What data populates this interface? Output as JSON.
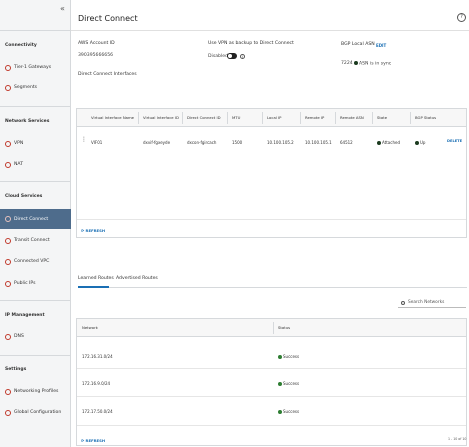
{
  "sidebar": {
    "collapse_glyph": "«",
    "sections": [
      {
        "title": "Connectivity"
      },
      {
        "title": "Network Services"
      },
      {
        "title": "Cloud Services"
      },
      {
        "title": "IP Management"
      },
      {
        "title": "Settings"
      }
    ],
    "items": [
      {
        "label": "Tier-1 Gateways",
        "icon": "gateway-icon"
      },
      {
        "label": "Segments",
        "icon": "segments-icon"
      },
      {
        "label": "VPN",
        "icon": "vpn-icon"
      },
      {
        "label": "NAT",
        "icon": "nat-icon"
      },
      {
        "label": "Direct Connect",
        "icon": "direct-connect-icon",
        "active": true
      },
      {
        "label": "Transit Connect",
        "icon": "transit-connect-icon"
      },
      {
        "label": "Connected VPC",
        "icon": "connected-vpc-icon"
      },
      {
        "label": "Public IPs",
        "icon": "public-ip-icon"
      },
      {
        "label": "DNS",
        "icon": "dns-icon"
      },
      {
        "label": "Networking Profiles",
        "icon": "networking-profiles-icon"
      },
      {
        "label": "Global Configuration",
        "icon": "global-config-icon"
      }
    ]
  },
  "header": {
    "title": "Direct Connect",
    "help_glyph": "?"
  },
  "summary": {
    "account_label": "AWS Account ID",
    "account_value": "390395666656",
    "vpn_label": "Use VPN as backup to Direct Connect",
    "vpn_state": "Disabled",
    "bgp_label": "BGP Local ASN",
    "bgp_edit": "EDIT",
    "bgp_value": "7224",
    "bgp_status": "ASN is in sync",
    "interfaces_label": "Direct Connect Interfaces"
  },
  "interfaces_table": {
    "columns": [
      "Virtual Interface Name",
      "Virtual Interface ID",
      "Direct Connect ID",
      "MTU",
      "Local IP",
      "Remote IP",
      "Remote ASN",
      "State",
      "BGP Status"
    ],
    "rows": [
      {
        "name": "VIF01",
        "vif_id": "dxvif-fgxeyde",
        "dx_id": "dxcon-fgircach",
        "mtu": "1500",
        "local_ip": "10.100.105.2",
        "remote_ip": "10.100.105.1",
        "remote_asn": "64512",
        "state": "Attached",
        "bgp_status": "Up",
        "action": "DELETE"
      }
    ],
    "refresh": "REFRESH"
  },
  "tabs": [
    {
      "label": "Learned Routes",
      "active": true
    },
    {
      "label": "Advertised Routes",
      "active": false
    }
  ],
  "search": {
    "placeholder": "Search Networks"
  },
  "routes_table": {
    "columns": [
      "Network",
      "Status"
    ],
    "rows": [
      {
        "network": "172.16.31.0/24",
        "status": "Success"
      },
      {
        "network": "172.16.9.0/24",
        "status": "Success"
      },
      {
        "network": "172.17.50.0/24",
        "status": "Success"
      }
    ],
    "refresh": "REFRESH",
    "pager": "1 - 10 of 10"
  },
  "colors": {
    "active_nav": "#4e6c8c",
    "link": "#1a6fb4",
    "success": "#2e7d32"
  }
}
